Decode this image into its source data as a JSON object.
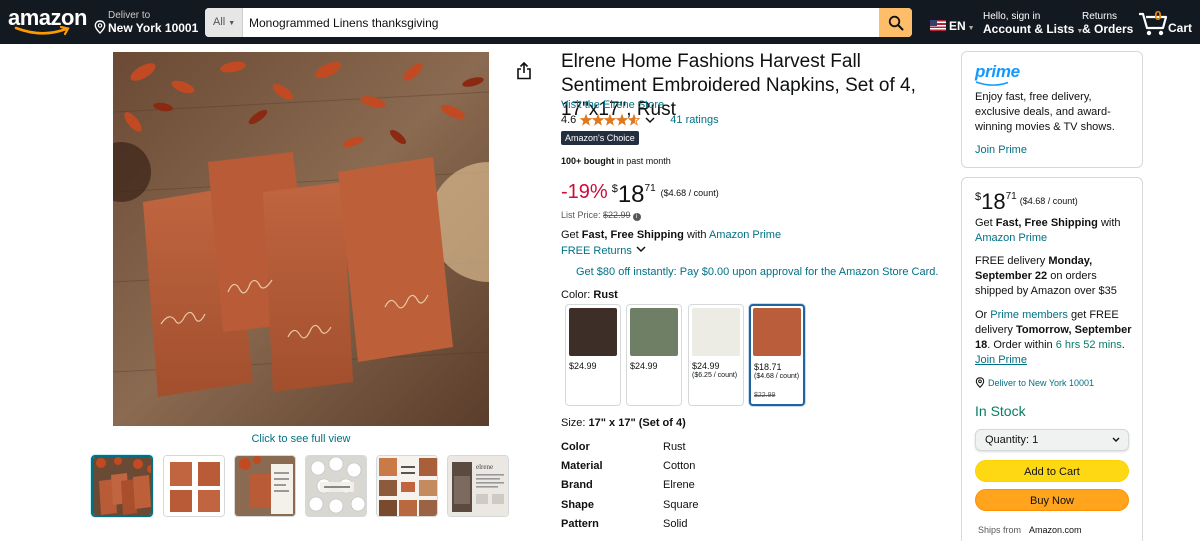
{
  "nav": {
    "logo_text": "amazon",
    "deliver_line1": "Deliver to",
    "deliver_line2": "New York 10001",
    "search_category": "All",
    "search_query": "Monogrammed Linens thanksgiving",
    "language": "EN",
    "account_line1": "Hello, sign in",
    "account_line2": "Account & Lists",
    "returns_line1": "Returns",
    "returns_line2": "& Orders",
    "cart_count": "0",
    "cart_label": "Cart",
    "colors": {
      "bg": "#131921",
      "search_button": "#febd69",
      "cart_count": "#f08804"
    }
  },
  "gallery": {
    "full_view_link": "Click to see full view",
    "image_embroidery": [
      "gather",
      "thankful",
      "grateful",
      "blessed"
    ],
    "thumbnails": [
      {
        "name": "thumb-1",
        "selected": true
      },
      {
        "name": "thumb-2",
        "selected": false
      },
      {
        "name": "thumb-3",
        "selected": false
      },
      {
        "name": "thumb-4",
        "selected": false
      },
      {
        "name": "thumb-5",
        "selected": false
      },
      {
        "name": "thumb-6",
        "selected": false
      }
    ],
    "thumb6_brand": "elrene"
  },
  "product": {
    "title": "Elrene Home Fashions Harvest Fall Sentiment Embroidered Napkins, Set of 4, 17\"x17\", Rust",
    "store_link": "Visit the Elrene Store",
    "rating": "4.6",
    "rating_value": 4.6,
    "ratings_count": "41 ratings",
    "badge": "Amazon's Choice",
    "bought_bold": "100+ bought",
    "bought_rest": "in past month",
    "discount": "-19%",
    "currency": "$",
    "price_whole": "18",
    "price_fraction": "71",
    "unit_price": "($4.68 / count)",
    "list_price_label": "List Price:",
    "list_price": "$22.99",
    "shipping_prefix": "Get",
    "shipping_bold": "Fast, Free Shipping",
    "shipping_with": "with",
    "shipping_link": "Amazon Prime",
    "free_returns": "FREE Returns",
    "card_offer": "Get $80 off instantly: Pay $0.00 upon approval for the Amazon Store Card.",
    "color_label": "Color:",
    "color_value": "Rust",
    "swatches": [
      {
        "color": "#3d2f28",
        "price": "$24.99",
        "unit": "",
        "list": "",
        "selected": false
      },
      {
        "color": "#6f7f65",
        "price": "$24.99",
        "unit": "",
        "list": "",
        "selected": false
      },
      {
        "color": "#ecebe4",
        "price": "$24.99",
        "unit": "($6.25 / count)",
        "list": "",
        "selected": false
      },
      {
        "color": "#b95d3a",
        "price": "$18.71",
        "unit": "($4.68 / count)",
        "list": "$22.99",
        "selected": true
      }
    ],
    "size_label": "Size:",
    "size_value": "17\" x 17\" (Set of 4)",
    "specs": [
      {
        "key": "Color",
        "value": "Rust"
      },
      {
        "key": "Material",
        "value": "Cotton"
      },
      {
        "key": "Brand",
        "value": "Elrene"
      },
      {
        "key": "Shape",
        "value": "Square"
      },
      {
        "key": "Pattern",
        "value": "Solid"
      }
    ]
  },
  "prime_box": {
    "logo_text": "prime",
    "text": "Enjoy fast, free delivery, exclusive deals, and award-winning movies & TV shows.",
    "join": "Join Prime"
  },
  "buy_box": {
    "currency": "$",
    "price_whole": "18",
    "price_fraction": "71",
    "unit_price": "($4.68 / count)",
    "ship_prefix": "Get",
    "ship_bold": "Fast, Free Shipping",
    "ship_with": "with",
    "ship_link": "Amazon Prime",
    "delivery_1": "FREE delivery",
    "delivery_bold": "Monday, September 22",
    "delivery_2": "on orders shipped by Amazon over $35",
    "or_prefix": "Or",
    "or_link": "Prime members",
    "or_mid": "get FREE delivery",
    "or_bold": "Tomorrow, September 18",
    "or_within": ". Order within",
    "or_time": "6 hrs 52 mins",
    "or_end": ".",
    "join_prime": "Join Prime",
    "location": "Deliver to New York 10001",
    "stock": "In Stock",
    "qty_label": "Quantity:",
    "qty_value": "1",
    "add_to_cart": "Add to Cart",
    "buy_now": "Buy Now",
    "ships_from_label": "Ships from",
    "ships_from_value": "Amazon.com",
    "colors": {
      "add_to_cart": "#ffd814",
      "buy_now": "#ffa41c",
      "stock": "#067d62"
    }
  }
}
